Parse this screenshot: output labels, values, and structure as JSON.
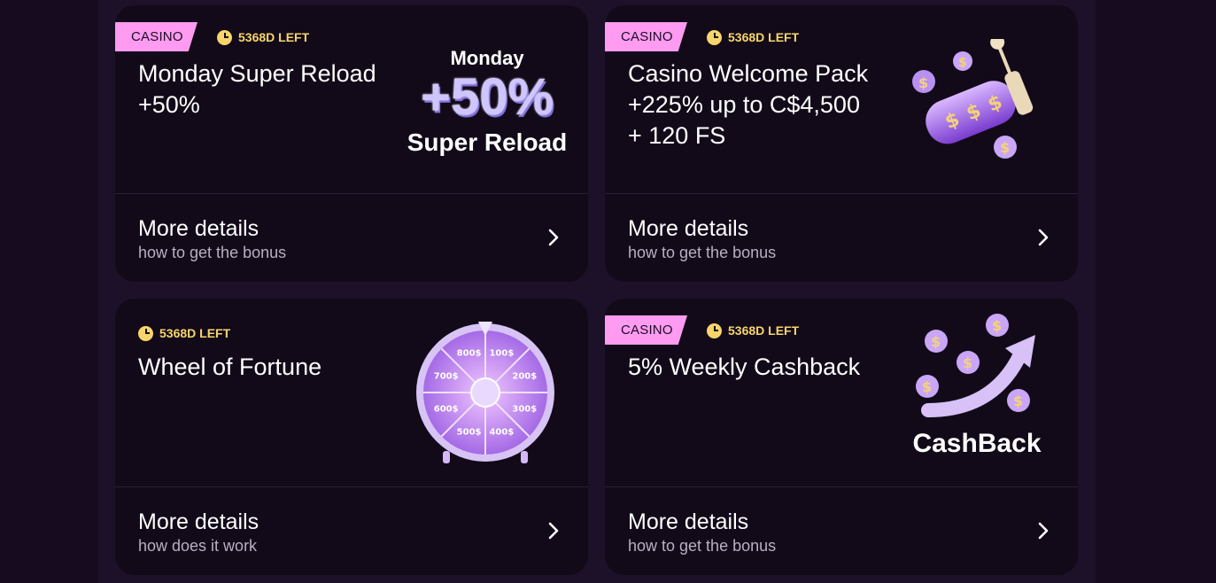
{
  "cards": [
    {
      "tag": "CASINO",
      "timer": "5368D LEFT",
      "title": "Monday Super Reload\n+50%",
      "art": {
        "top": "Monday",
        "big": "+50%",
        "bottom": "Super Reload"
      },
      "more": "More details",
      "sub": "how to get the bonus"
    },
    {
      "tag": "CASINO",
      "timer": "5368D LEFT",
      "title": "Casino Welcome Pack\n+225% up to C$4,500\n+ 120 FS",
      "more": "More details",
      "sub": "how to get the bonus"
    },
    {
      "timer": "5368D LEFT",
      "title": "Wheel of Fortune",
      "art": {
        "segments": [
          "100$",
          "200$",
          "300$",
          "400$",
          "500$",
          "600$",
          "700$",
          "800$"
        ]
      },
      "more": "More details",
      "sub": "how does it work"
    },
    {
      "tag": "CASINO",
      "timer": "5368D LEFT",
      "title": "5% Weekly Cashback",
      "art": {
        "label": "CashBack"
      },
      "more": "More details",
      "sub": "how to get the bonus"
    }
  ],
  "colors": {
    "tag": "#ff9bf1",
    "timer": "#f7d56a",
    "card": "#120a19",
    "page": "#170c1f"
  }
}
